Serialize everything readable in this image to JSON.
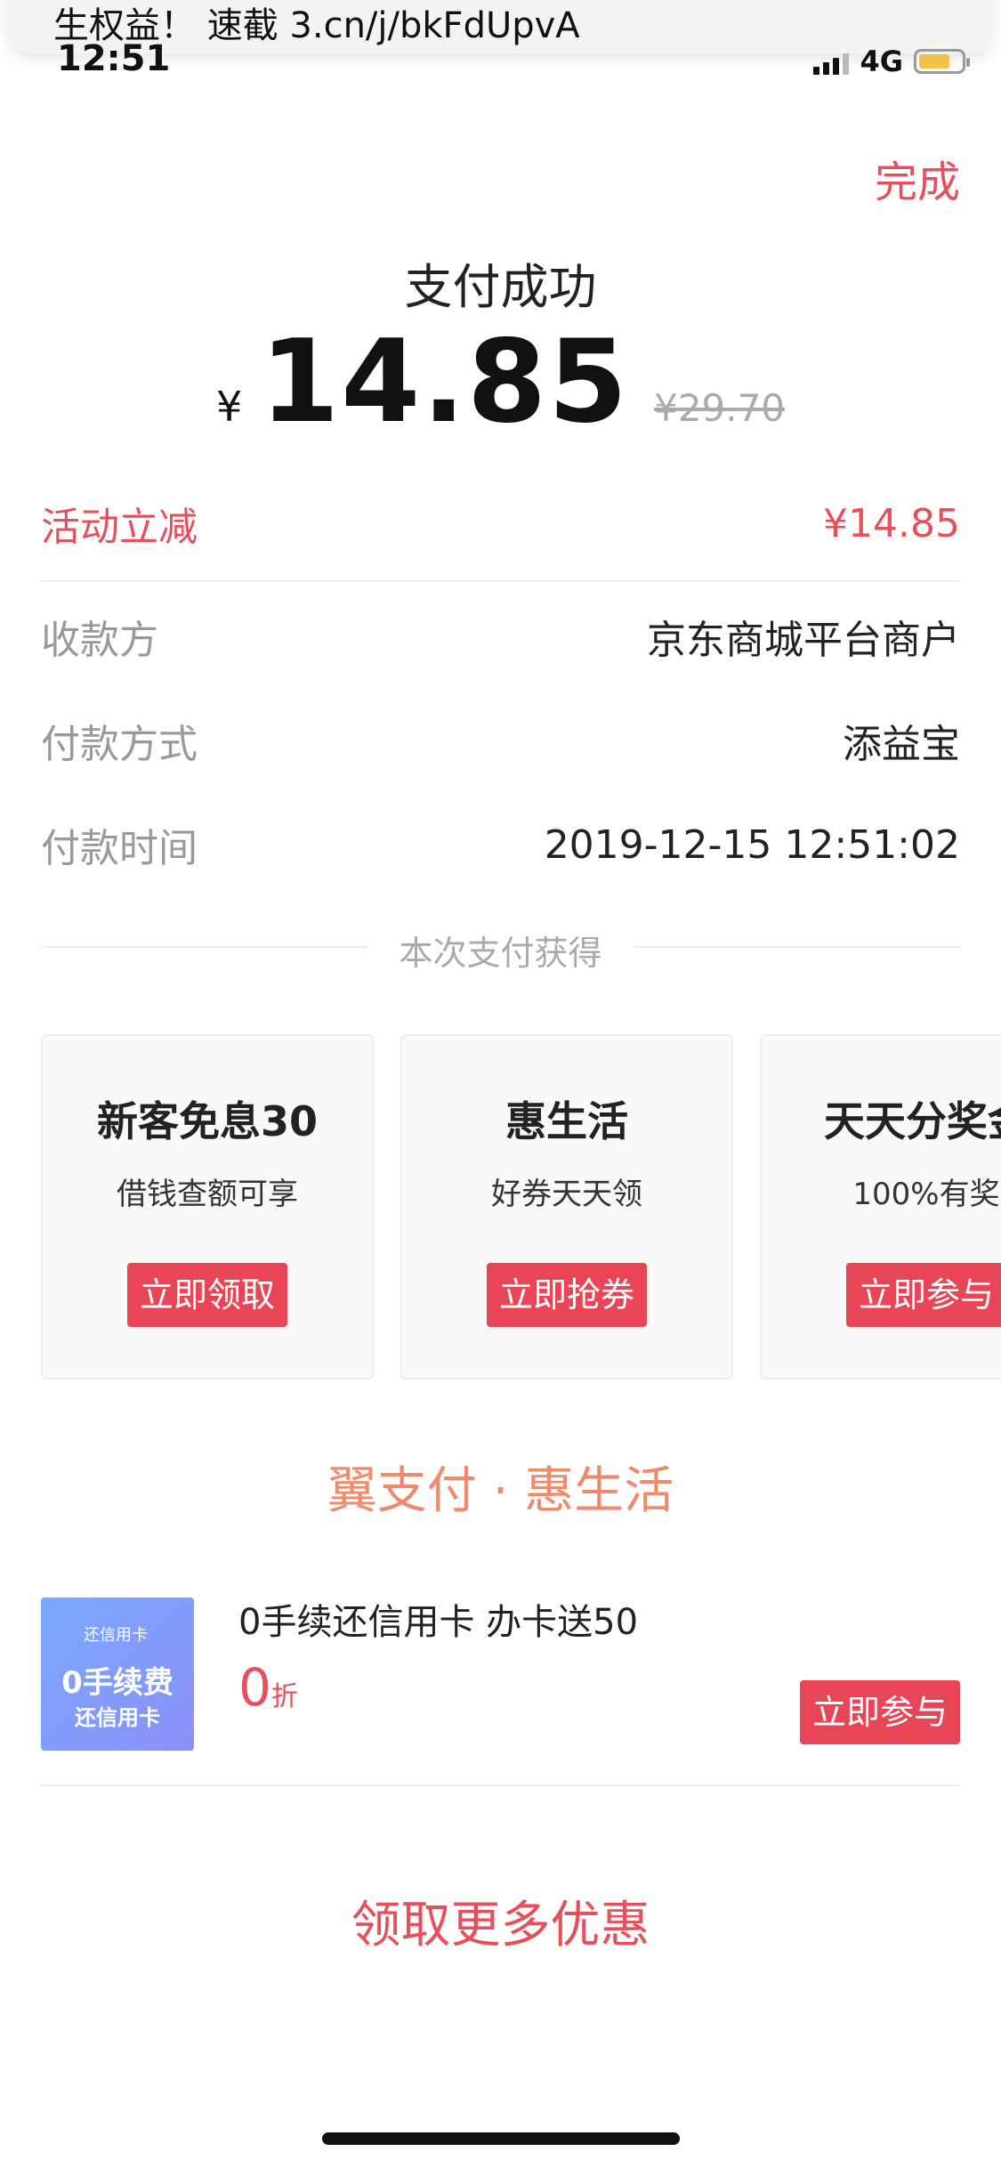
{
  "banner": {
    "text": "生权益！ 速截 3.cn/j/bkFdUpvA"
  },
  "status_bar": {
    "time": "12:51",
    "network": "4G"
  },
  "header": {
    "done_label": "完成"
  },
  "payment": {
    "title": "支付成功",
    "currency": "¥",
    "amount": "14.85",
    "original_amount": "¥29.70"
  },
  "details": [
    {
      "label": "活动立减",
      "value": "¥14.85"
    },
    {
      "label": "收款方",
      "value": "京东商城平台商户"
    },
    {
      "label": "付款方式",
      "value": "添益宝"
    },
    {
      "label": "付款时间",
      "value": "2019-12-15 12:51:02"
    }
  ],
  "earned_label": "本次支付获得",
  "cards": [
    {
      "title": "新客免息30",
      "subtitle": "借钱查额可享",
      "button": "立即领取"
    },
    {
      "title": "惠生活",
      "subtitle": "好券天天领",
      "button": "立即抢券"
    },
    {
      "title": "天天分奖金",
      "subtitle": "100%有奖",
      "button": "立即参与"
    }
  ],
  "section_title": "翼支付 · 惠生活",
  "promo": {
    "thumb_tag": "还信用卡",
    "thumb_big": "0手续费",
    "thumb_small": "还信用卡",
    "title": "0手续还信用卡 办卡送50",
    "price": "0",
    "price_unit": "折",
    "button": "立即参与"
  },
  "more_label": "领取更多优惠",
  "colors": {
    "accent": "#e64f5c",
    "button": "#e84657",
    "section_title": "#ef8a6a",
    "battery": "#f3c244"
  }
}
